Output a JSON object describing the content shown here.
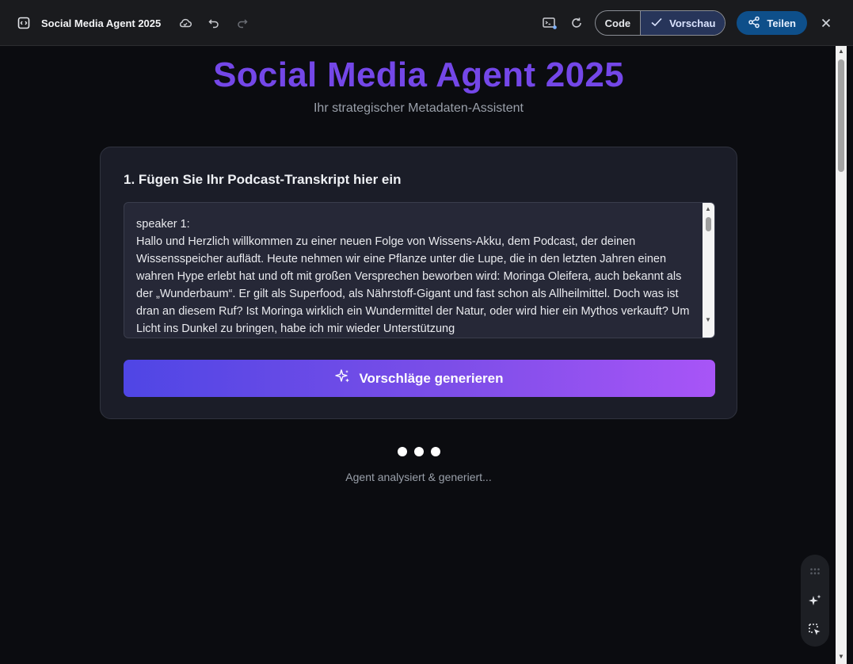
{
  "toolbar": {
    "app_title": "Social Media Agent 2025",
    "icons": [
      "app-frame-icon",
      "cloud-sync-icon",
      "undo-icon",
      "redo-icon",
      "terminal-icon",
      "refresh-icon",
      "share-icon",
      "close-icon"
    ],
    "code_label": "Code",
    "preview_label": "Vorschau",
    "share_label": "Teilen"
  },
  "hero": {
    "title": "Social Media Agent 2025",
    "subtitle": "Ihr strategischer Metadaten-Assistent"
  },
  "card": {
    "label": "1. Fügen Sie Ihr Podcast-Transkript hier ein",
    "transcript": "speaker 1:\nHallo und Herzlich willkommen zu einer neuen Folge von Wissens-Akku, dem Podcast, der deinen Wissensspeicher auflädt. Heute nehmen wir eine Pflanze unter die Lupe, die in den letzten Jahren einen wahren Hype erlebt hat und oft mit großen Versprechen beworben wird: Moringa Oleifera, auch bekannt als der „Wunderbaum“. Er gilt als Superfood, als Nährstoff-Gigant und fast schon als Allheilmittel. Doch was ist dran an diesem Ruf? Ist Moringa wirklich ein Wundermittel der Natur, oder wird hier ein Mythos verkauft? Um Licht ins Dunkel zu bringen, habe ich mir wieder Unterstützung",
    "generate_label": "Vorschläge generieren"
  },
  "loading": {
    "status": "Agent analysiert & generiert..."
  },
  "colors": {
    "accent": "#7447e8",
    "button_gradient_start": "#4f46e5",
    "button_gradient_end": "#a855f7",
    "share": "#0e4f8a"
  }
}
